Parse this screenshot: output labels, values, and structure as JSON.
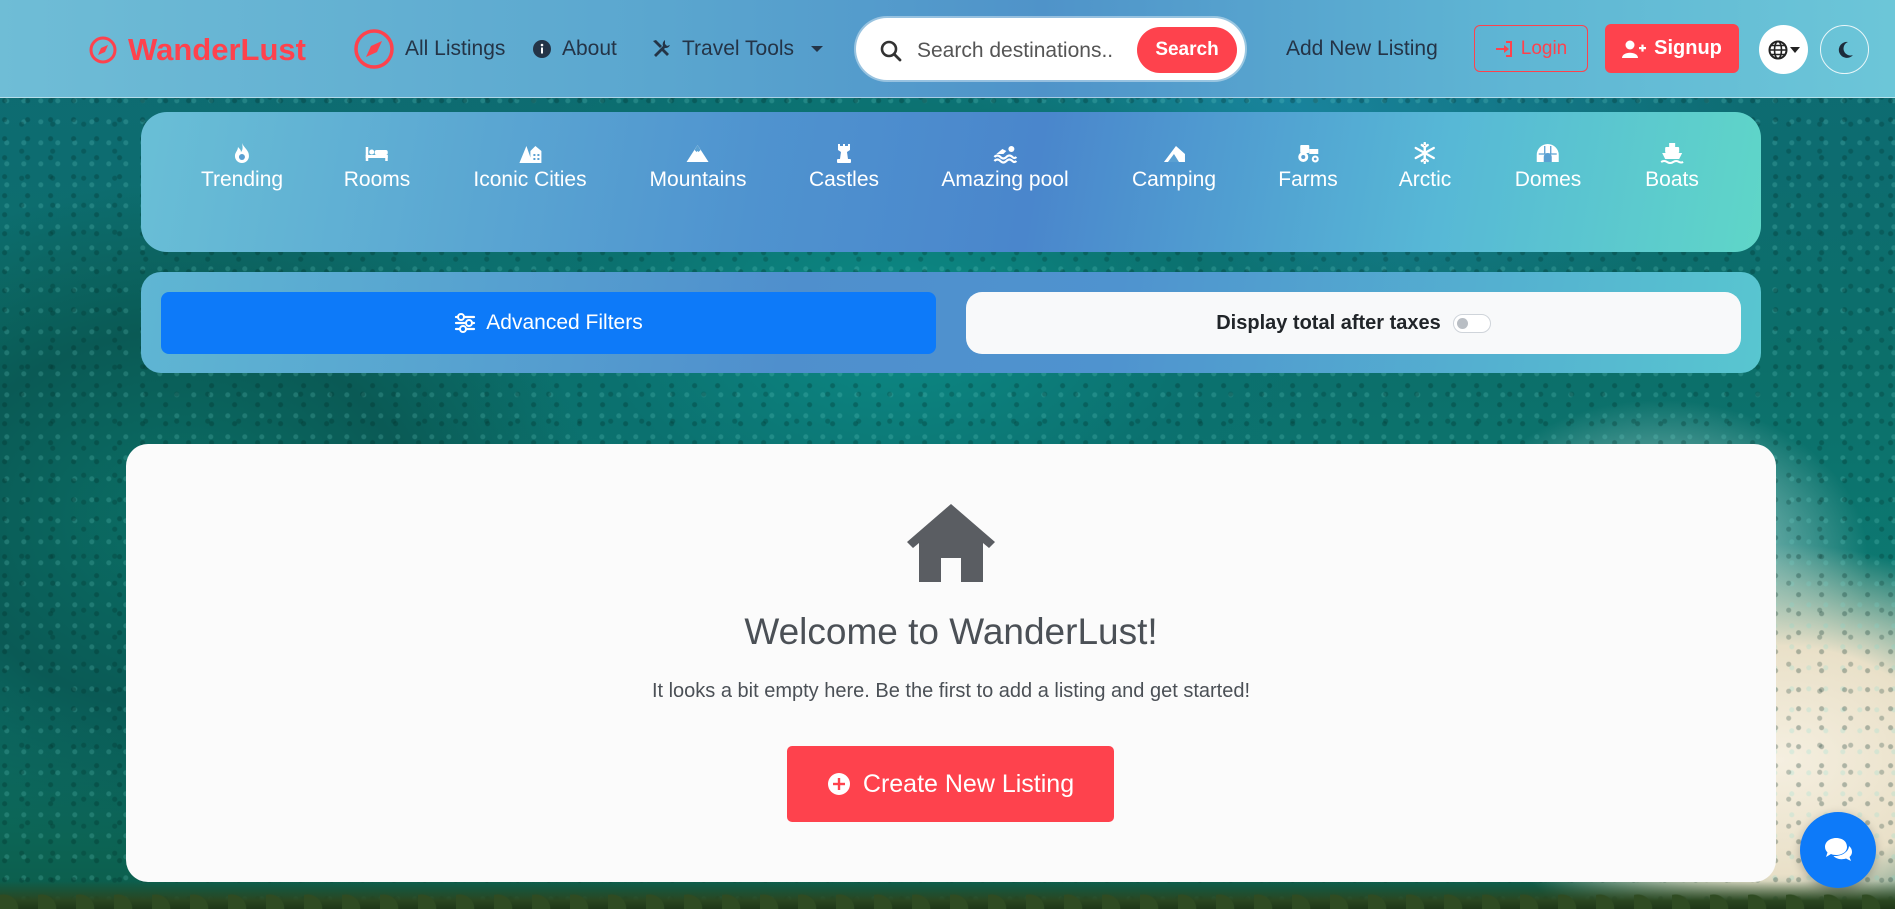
{
  "brand": {
    "name": "WanderLust",
    "color": "#fe424d"
  },
  "nav": {
    "all_listings": "All Listings",
    "about": "About",
    "travel_tools": "Travel Tools",
    "add_new_listing": "Add New Listing",
    "login": "Login",
    "signup": "Signup"
  },
  "search": {
    "placeholder": "Search destinations..",
    "button": "Search"
  },
  "categories": [
    {
      "label": "Trending",
      "icon": "fire-icon"
    },
    {
      "label": "Rooms",
      "icon": "bed-icon"
    },
    {
      "label": "Iconic Cities",
      "icon": "city-icon"
    },
    {
      "label": "Mountains",
      "icon": "mountain-icon"
    },
    {
      "label": "Castles",
      "icon": "castle-icon"
    },
    {
      "label": "Amazing pool",
      "icon": "swimmer-icon"
    },
    {
      "label": "Camping",
      "icon": "campground-icon"
    },
    {
      "label": "Farms",
      "icon": "tractor-icon"
    },
    {
      "label": "Arctic",
      "icon": "snowflake-icon"
    },
    {
      "label": "Domes",
      "icon": "igloo-icon"
    },
    {
      "label": "Boats",
      "icon": "ship-icon"
    }
  ],
  "filters": {
    "advanced_filters": "Advanced Filters",
    "display_total_after_taxes": "Display total after taxes",
    "taxes_toggle_on": false
  },
  "welcome": {
    "title": "Welcome to WanderLust!",
    "subtitle": "It looks a bit empty here. Be the first to add a listing and get started!",
    "create_button": "Create New Listing"
  },
  "colors": {
    "accent": "#fe424d",
    "primary": "#0d7af9"
  }
}
